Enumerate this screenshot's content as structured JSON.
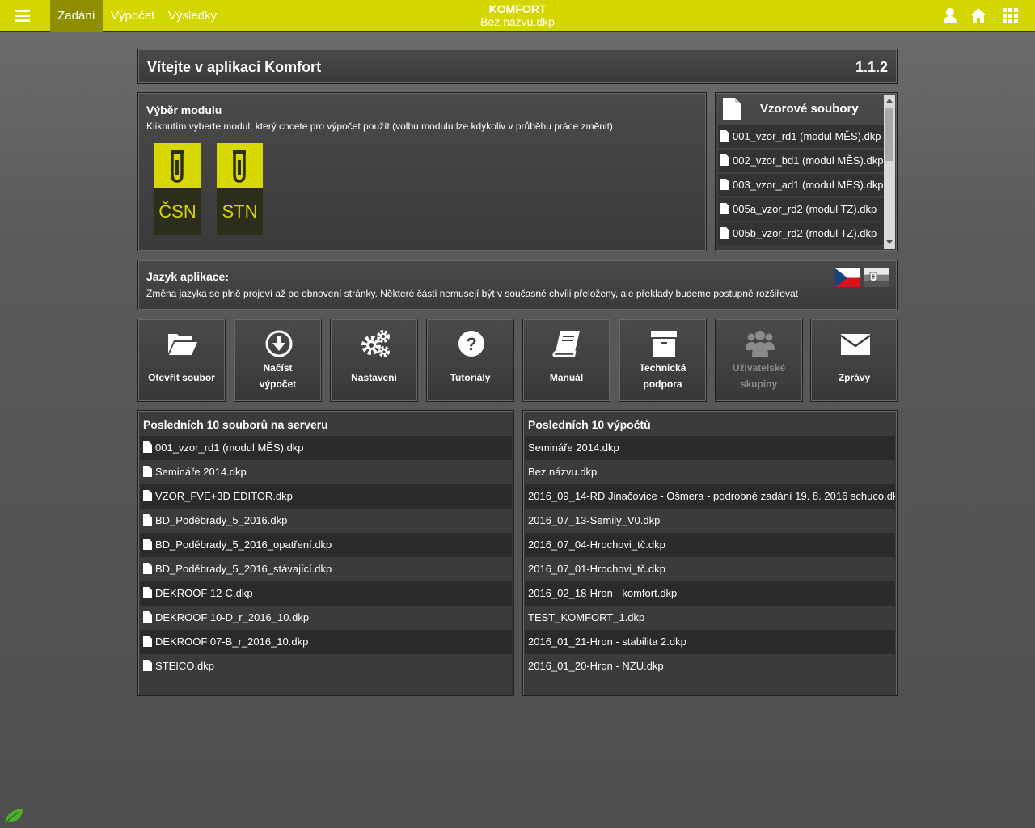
{
  "topbar": {
    "menu_icon": "hamburger-menu-icon",
    "tabs": [
      {
        "label": "Zadání",
        "active": true
      },
      {
        "label": "Výpočet",
        "active": false
      },
      {
        "label": "Výsledky",
        "active": false
      }
    ],
    "app_title": "KOMFORT",
    "file_name": "Bez názvu.dkp",
    "right_icons": [
      "user-icon",
      "home-icon",
      "grid-apps-icon"
    ],
    "accent_color": "#d4d600"
  },
  "welcome": {
    "title": "Vítejte v aplikaci Komfort",
    "version": "1.1.2"
  },
  "modules": {
    "heading": "Výběr modulu",
    "hint": "Kliknutím vyberte modul, který chcete pro výpočet použít (volbu modulu lze kdykoliv v průběhu práce změnit)",
    "items": [
      {
        "label": "ČSN",
        "icon": "test-tube-icon"
      },
      {
        "label": "STN",
        "icon": "test-tube-icon"
      }
    ]
  },
  "samples": {
    "heading": "Vzorové soubory",
    "icon": "document-icon",
    "items": [
      "001_vzor_rd1 (modul MĚS).dkp",
      "002_vzor_bd1 (modul MĚS).dkp",
      "003_vzor_ad1 (modul MĚS).dkp",
      "005a_vzor_rd2 (modul TZ).dkp",
      "005b_vzor_rd2 (modul TZ).dkp"
    ]
  },
  "language": {
    "heading": "Jazyk aplikace:",
    "hint": "Změna jazyka se plně projeví až po obnovení stránky. Některé části nemusejí být v současné chvíli přeloženy, ale překlady budeme postupně rozšiřovat",
    "flags": [
      "czech-flag-icon",
      "slovak-flag-icon"
    ]
  },
  "tools": [
    {
      "line1": "Otevřít soubor",
      "line2": "",
      "icon": "folder-open-icon",
      "enabled": true
    },
    {
      "line1": "Načíst",
      "line2": "výpočet",
      "icon": "download-circle-icon",
      "enabled": true
    },
    {
      "line1": "Nastavení",
      "line2": "",
      "icon": "gears-icon",
      "enabled": true
    },
    {
      "line1": "Tutoriály",
      "line2": "",
      "icon": "question-circle-icon",
      "enabled": true
    },
    {
      "line1": "Manuál",
      "line2": "",
      "icon": "book-icon",
      "enabled": true
    },
    {
      "line1": "Technická",
      "line2": "podpora",
      "icon": "archive-box-icon",
      "enabled": true
    },
    {
      "line1": "Uživatelské",
      "line2": "skupiny",
      "icon": "users-group-icon",
      "enabled": false
    },
    {
      "line1": "Zprávy",
      "line2": "",
      "icon": "envelope-icon",
      "enabled": true
    }
  ],
  "recent_files": {
    "heading": "Posledních 10 souborů na serveru",
    "items": [
      "001_vzor_rd1 (modul MĚS).dkp",
      "Semináře 2014.dkp",
      "VZOR_FVE+3D EDITOR.dkp",
      "BD_Poděbrady_5_2016.dkp",
      "BD_Poděbrady_5_2016_opatření.dkp",
      "BD_Poděbrady_5_2016_stávající.dkp",
      "DEKROOF 12-C.dkp",
      "DEKROOF 10-D_r_2016_10.dkp",
      "DEKROOF 07-B_r_2016_10.dkp",
      "STEICO.dkp"
    ]
  },
  "recent_calcs": {
    "heading": "Posledních 10 výpočtů",
    "items": [
      "Semináře 2014.dkp",
      "Bez názvu.dkp",
      "2016_09_14-RD Jinačovice - Ošmera - podrobné zadání 19. 8. 2016 schuco.dkp",
      "2016_07_13-Semily_V0.dkp",
      "2016_07_04-Hrochovi_tč.dkp",
      "2016_07_01-Hrochovi_tč.dkp",
      "2016_02_18-Hron - komfort.dkp",
      "TEST_KOMFORT_1.dkp",
      "2016_01_21-Hron - stabilita 2.dkp",
      "2016_01_20-Hron - NZU.dkp"
    ]
  },
  "footer": {
    "icon": "leaf-icon"
  }
}
